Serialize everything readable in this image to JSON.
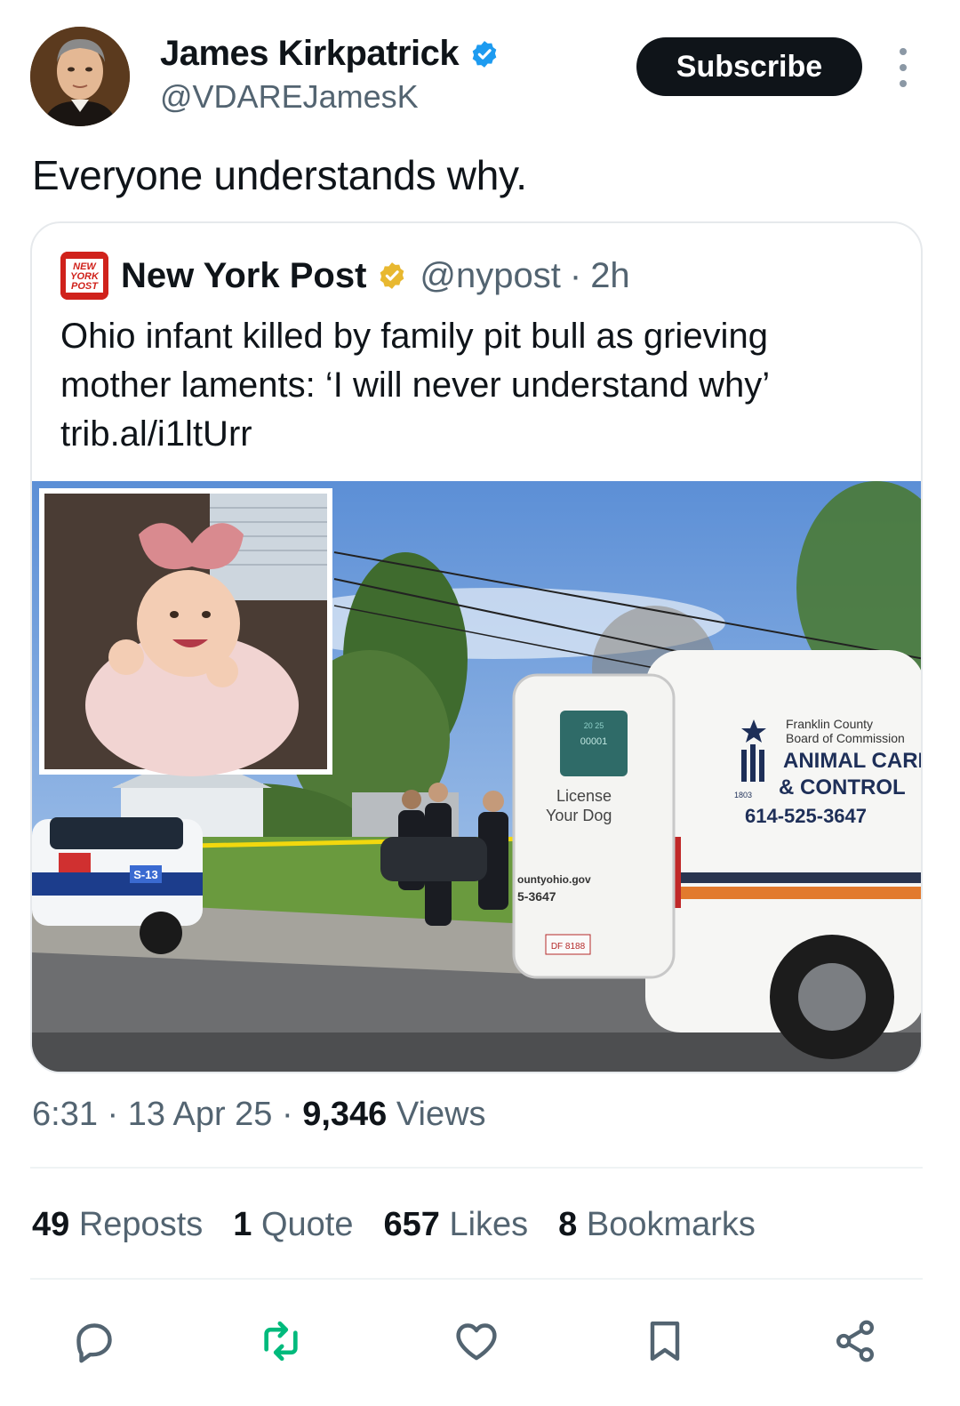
{
  "author": {
    "name": "James Kirkpatrick",
    "handle": "@VDAREJamesK",
    "verified": true,
    "avatar_icon": "portrait-avatar"
  },
  "subscribe_label": "Subscribe",
  "more_icon": "more-vertical-icon",
  "tweet_text": "Everyone understands why.",
  "quoted": {
    "name": "New York Post",
    "logo_text": "NEW YORK POST",
    "handle": "@nypost",
    "separator": "·",
    "time": "2h",
    "text_lines": [
      "Ohio infant killed by family pit bull as grieving",
      "mother laments: ‘I will never understand why’",
      "trib.al/i1ltUrr"
    ],
    "image": {
      "van_text": {
        "line1": "Franklin County",
        "line2": "Board of Commission",
        "line3": "ANIMAL CARE",
        "line4": "& CONTROL",
        "phone": "614-525-3647",
        "year": "1803",
        "door_line1": "License",
        "door_line2": "Your Dog",
        "door_web": "ountyohio.gov",
        "door_phone": "5-3647",
        "tag_top": "20 25",
        "tag_number": "00001",
        "plate": "DF 8188"
      },
      "police_car_number": "S-13"
    }
  },
  "meta": {
    "time": "6:31",
    "dot": "·",
    "date": "13 Apr 25",
    "views_count": "9,346",
    "views_label": "Views"
  },
  "stats": [
    {
      "count": "49",
      "label": "Reposts"
    },
    {
      "count": "1",
      "label": "Quote"
    },
    {
      "count": "657",
      "label": "Likes"
    },
    {
      "count": "8",
      "label": "Bookmarks"
    }
  ],
  "actions": [
    "reply-icon",
    "repost-icon",
    "like-icon",
    "bookmark-icon",
    "share-icon"
  ],
  "colors": {
    "verified_blue": "#1d9bf0",
    "gold_check": "#e8b830",
    "repost_green": "#00ba7c",
    "icon_gray": "#536471",
    "nypost_red": "#d0221b"
  }
}
